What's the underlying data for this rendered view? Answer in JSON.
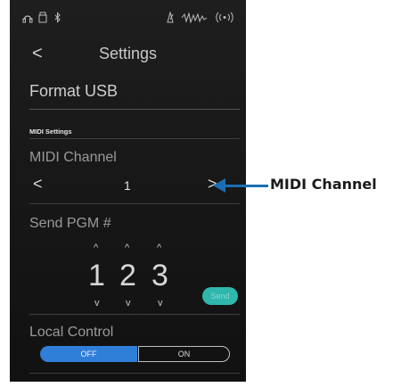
{
  "status_icons": {
    "headphones": "headphones-icon",
    "usb": "usb-icon",
    "bluetooth": "bluetooth-icon",
    "metronome": "metronome-icon",
    "midi": "midi-waveform-icon",
    "wireless": "wireless-icon"
  },
  "nav": {
    "title": "Settings",
    "back": "<"
  },
  "format_usb": "Format USB",
  "section_header": "MIDI Settings",
  "midi_channel": {
    "label": "MIDI Channel",
    "value": "1",
    "left_arrow": "<",
    "right_arrow": ">"
  },
  "send_pgm": {
    "label": "Send PGM #",
    "digits": [
      "1",
      "2",
      "3"
    ],
    "up": "^",
    "down": "v",
    "send_label": "Send"
  },
  "local_control": {
    "label": "Local Control",
    "off": "OFF",
    "on": "ON",
    "selected": "OFF"
  },
  "annotation": {
    "label": "MIDI Channel"
  },
  "colors": {
    "accent_blue": "#2f7ed8",
    "send_teal": "#2fb6ad",
    "annotation_blue": "#1a6fb4"
  }
}
